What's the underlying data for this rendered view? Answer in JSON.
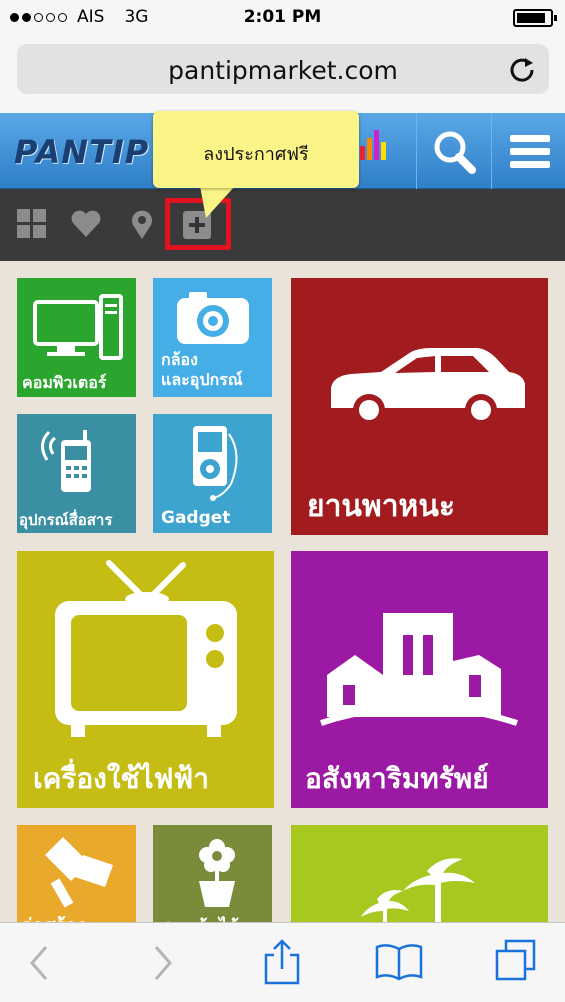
{
  "status_bar": {
    "carrier": "AIS",
    "network": "3G",
    "time": "2:01 PM"
  },
  "browser": {
    "url": "pantipmarket.com"
  },
  "site": {
    "logo": "PANTIP"
  },
  "toolbar": {
    "tooltip": "ลงประกาศฟรี"
  },
  "categories": [
    {
      "label": "คอมพิวเตอร์"
    },
    {
      "label": "กล้อง"
    },
    {
      "label": "และอุปกรณ์"
    },
    {
      "label": "ยานพาหนะ"
    },
    {
      "label": "อุปกรณ์สื่อสาร"
    },
    {
      "label": "Gadget"
    },
    {
      "label": "เครื่องใช้ไฟฟ้า"
    },
    {
      "label": "อสังหาริมทรัพย์"
    },
    {
      "label": "ก่อสร้าง"
    },
    {
      "label": "สวน ต้นไม้"
    }
  ],
  "colors": {
    "header_blue": "#3a8ad6",
    "toolbar_dark": "#3a3a3a",
    "tooltip_yellow": "#fbf487",
    "highlight_red": "#e0131e",
    "tile_green": "#2aa52d",
    "tile_skyblue": "#45aee6",
    "tile_red": "#a21b1f",
    "tile_teal": "#3a8fa2",
    "tile_olive": "#c5bd14",
    "tile_purple": "#9c1aa3",
    "tile_orange": "#e9a92a",
    "tile_moss": "#7a8b3a",
    "tile_lime": "#a6c81f"
  }
}
